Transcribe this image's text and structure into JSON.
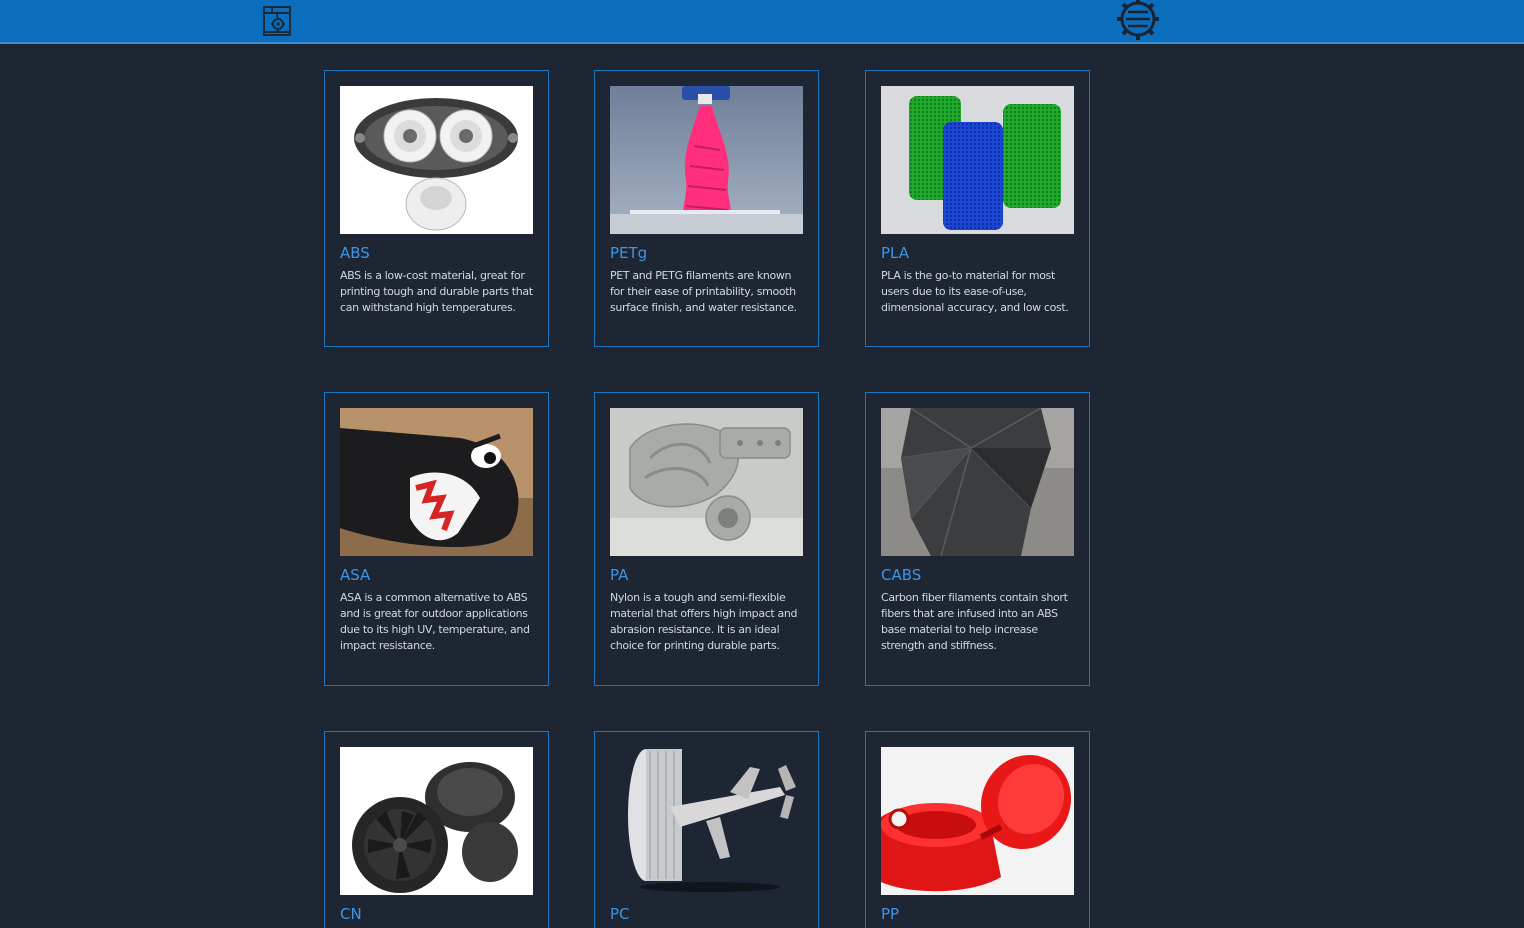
{
  "header": {
    "logo_icon": "printer-gear-logo-icon",
    "menu_icon": "gear-hamburger-menu-icon",
    "background": "#0a6ebd"
  },
  "materials": [
    {
      "name": "ABS",
      "description": "ABS is a low-cost material, great for printing tough and durable parts that can withstand high temperatures.",
      "image": "white-gear-pump"
    },
    {
      "name": "PETg",
      "description": "PET and PETG filaments are known for their ease of printability, smooth surface finish, and water resistance.",
      "image": "pink-vase-on-printer-bed"
    },
    {
      "name": "PLA",
      "description": "PLA is the go-to material for most users due to its ease-of-use, dimensional accuracy, and low cost.",
      "image": "green-blue-mesh-cups"
    },
    {
      "name": "ASA",
      "description": "ASA is a common alternative to ABS and is great for outdoor applications due to its high UV, temperature, and impact resistance.",
      "image": "bullet-bill-print"
    },
    {
      "name": "PA",
      "description": "Nylon is a tough and semi-flexible material that offers high impact and abrasion resistance. It is an ideal choice for printing durable parts.",
      "image": "grey-intake-manifold"
    },
    {
      "name": "CABS",
      "description": "Carbon fiber filaments contain short fibers that are infused into an ABS base material to help increase strength and stiffness.",
      "image": "dark-faceted-vase"
    },
    {
      "name": "CN",
      "description": "",
      "image": "black-ducted-fan-parts"
    },
    {
      "name": "PC",
      "description": "",
      "image": "clear-spool-and-airplane"
    },
    {
      "name": "PP",
      "description": "",
      "image": "red-flip-cap"
    }
  ],
  "colors": {
    "page_bg": "#1e2634",
    "card_border": "#1d76c0",
    "title": "#3d95e6",
    "text": "#d2d7df"
  }
}
